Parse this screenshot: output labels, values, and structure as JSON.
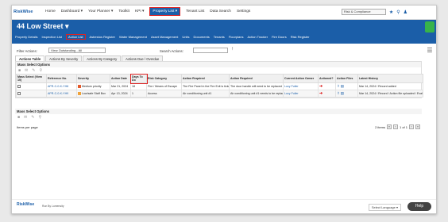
{
  "app": {
    "logo_text": "RiskWise",
    "footer_logo": "RiskWise",
    "powered_by": "Run By Lumensity"
  },
  "nav": {
    "items": [
      "Home",
      "Dashboard ▾",
      "Your Planner ▾",
      "Toolkit",
      "KPI ▾"
    ],
    "active": "Property List ▾",
    "after": [
      "Tenant List",
      "Data Search",
      "Settings"
    ]
  },
  "org_select": "Risk & Compliance",
  "property": {
    "title": "44 Low Street ▾"
  },
  "subnav": {
    "before": [
      "Property Details",
      "Inspection List"
    ],
    "active": "Action List",
    "after": [
      "Asbestos Register",
      "Water Management",
      "Asset Management",
      "Units",
      "Documents",
      "Tenants",
      "Floorplans",
      "Action Tracker",
      "Fire Doors",
      "Risk Register"
    ]
  },
  "filters": {
    "label": "Filter Actions:",
    "select_value": "View Outstanding - All",
    "search_label": "Search Actions:"
  },
  "tabs": [
    "Actions Table",
    "Actions By Severity",
    "Actions By Category",
    "Actions Due / Overdue"
  ],
  "multi_select": {
    "title": "Mass Select Options"
  },
  "table": {
    "headers": [
      "Mass Select (View 10)",
      "Reference No.",
      "Severity",
      "Action Date",
      "Days To Do",
      "Risk Category",
      "Action Required",
      "Action Required",
      "Current Action Owner",
      "Actioned?",
      "Action Files",
      "Latest History"
    ],
    "rows": [
      {
        "ref": "APR-C-0-K-YH8",
        "severity": "Medium priority",
        "sev_color": "#e55a2b",
        "date": "Mar 21, 2024",
        "days": "18",
        "category": "Fire / Means of Escape",
        "req1": "The Fire Panel in the Fire Exit is ticketed",
        "req2": "The door handle will need to be replaced",
        "owner": "Lucy Fuller",
        "history": "Mar 14, 2024 / Record added"
      },
      {
        "ref": "APR-C-0-K-YH9",
        "severity": "Low/safe Staff Box",
        "sev_color": "#f0a33a",
        "date": "Apr 13, 2024",
        "days": "1",
        "category": "Access",
        "req1": "Air conditioning unit #1",
        "req2": "Air conditioning unit #1 needs to be replaced",
        "owner": "Lucy Fuller",
        "history": "Mar 14, 2024 / Record / Action file uploaded / Evaluation"
      }
    ]
  },
  "pager": {
    "per_page": "Items per page",
    "count": "2 items",
    "page": "1 of 1"
  },
  "language": "Select Language ▾",
  "help": "Help"
}
